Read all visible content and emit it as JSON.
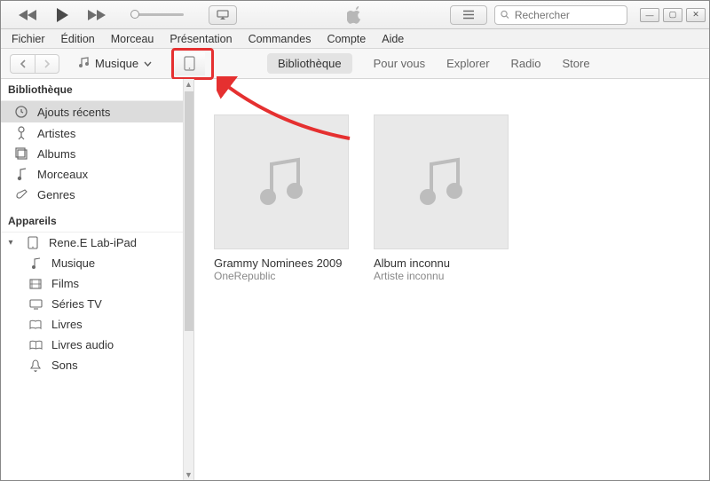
{
  "search": {
    "placeholder": "Rechercher"
  },
  "menu": {
    "items": [
      "Fichier",
      "Édition",
      "Morceau",
      "Présentation",
      "Commandes",
      "Compte",
      "Aide"
    ]
  },
  "toolbar": {
    "media_label": "Musique",
    "tabs": [
      "Bibliothèque",
      "Pour vous",
      "Explorer",
      "Radio",
      "Store"
    ],
    "active_tab": "Bibliothèque"
  },
  "sidebar": {
    "section_library": "Bibliothèque",
    "library_items": [
      {
        "key": "recents",
        "label": "Ajouts récents",
        "selected": true
      },
      {
        "key": "artists",
        "label": "Artistes"
      },
      {
        "key": "albums",
        "label": "Albums"
      },
      {
        "key": "songs",
        "label": "Morceaux"
      },
      {
        "key": "genres",
        "label": "Genres"
      }
    ],
    "section_devices": "Appareils",
    "device": {
      "label": "Rene.E Lab-iPad"
    },
    "device_children": [
      {
        "key": "music",
        "label": "Musique"
      },
      {
        "key": "movies",
        "label": "Films"
      },
      {
        "key": "tv",
        "label": "Séries TV"
      },
      {
        "key": "books",
        "label": "Livres"
      },
      {
        "key": "audiob",
        "label": "Livres audio"
      },
      {
        "key": "tones",
        "label": "Sons"
      }
    ]
  },
  "albums": [
    {
      "title": "Grammy Nominees 2009",
      "artist": "OneRepublic"
    },
    {
      "title": "Album inconnu",
      "artist": "Artiste inconnu"
    }
  ]
}
